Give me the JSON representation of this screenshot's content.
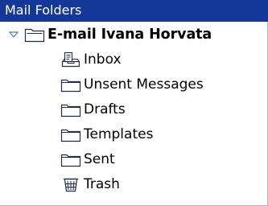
{
  "panel": {
    "title": "Mail Folders"
  },
  "account": {
    "name": "E-mail Ivana Horvata",
    "expanded": true,
    "icon": "account-folder-icon"
  },
  "folders": [
    {
      "label": "Inbox",
      "icon": "inbox-icon"
    },
    {
      "label": "Unsent Messages",
      "icon": "folder-icon"
    },
    {
      "label": "Drafts",
      "icon": "folder-icon"
    },
    {
      "label": "Templates",
      "icon": "folder-icon"
    },
    {
      "label": "Sent",
      "icon": "folder-icon"
    },
    {
      "label": "Trash",
      "icon": "trash-icon"
    }
  ],
  "colors": {
    "header_bg": "#14389a",
    "header_text": "#ffffff",
    "panel_bg": "#ffffff",
    "panel_border": "#aeb2bc"
  }
}
